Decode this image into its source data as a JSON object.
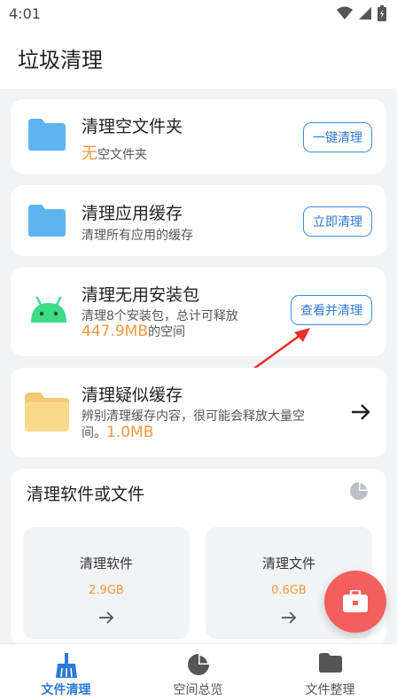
{
  "status": {
    "time": "4:01"
  },
  "header": {
    "title": "垃圾清理"
  },
  "cards": [
    {
      "title": "清理空文件夹",
      "sub_highlight": "无",
      "sub_rest": "空文件夹",
      "button": "一键清理"
    },
    {
      "title": "清理应用缓存",
      "sub": "清理所有应用的缓存",
      "button": "立即清理"
    },
    {
      "title": "清理无用安装包",
      "sub_line1": "清理8个安装包，总计可释放",
      "sub_highlight": "447.9MB",
      "sub_rest": "的空间",
      "button": "查看并清理"
    },
    {
      "title": "清理疑似缓存",
      "sub_line1": "辨别清理缓存内容，很可能会释放大量空",
      "sub_line2_prefix": "间。",
      "sub_highlight": "1.0MB"
    }
  ],
  "section": {
    "title": "清理软件或文件",
    "tiles": [
      {
        "label": "清理软件",
        "value": "2.9GB"
      },
      {
        "label": "清理文件",
        "value": "0.6GB"
      }
    ]
  },
  "bottom_nav": [
    {
      "label": "文件清理",
      "active": true
    },
    {
      "label": "空间总览",
      "active": false
    },
    {
      "label": "文件整理",
      "active": false
    }
  ],
  "colors": {
    "accent": "#2d7ad6",
    "highlight": "#f29a3e",
    "fab": "#f25f5c",
    "folder_blue": "#5db4ef",
    "folder_yellow": "#fcd98a",
    "android_green": "#3ddc84"
  },
  "icons": {
    "fab": "toolbox-icon",
    "pie": "pie-chart-icon"
  }
}
